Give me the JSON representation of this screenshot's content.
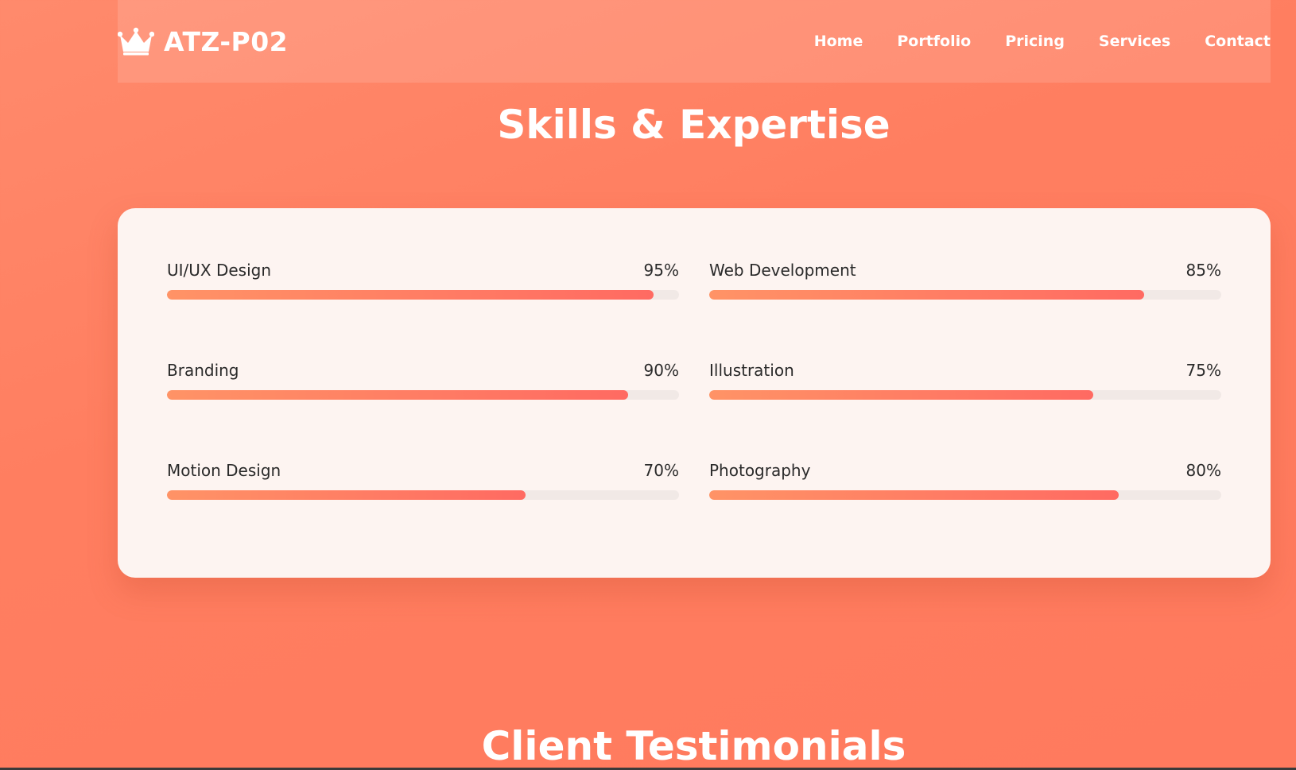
{
  "nav": {
    "brand_name": "ATZ-P02",
    "brand_icon": "crown-icon",
    "links": [
      "Home",
      "Portfolio",
      "Pricing",
      "Services",
      "Contact"
    ]
  },
  "skills_section": {
    "title": "Skills & Expertise",
    "skills": [
      {
        "name": "UI/UX Design",
        "percent_label": "95%",
        "level": 95
      },
      {
        "name": "Web Development",
        "percent_label": "85%",
        "level": 85
      },
      {
        "name": "Branding",
        "percent_label": "90%",
        "level": 90
      },
      {
        "name": "Illustration",
        "percent_label": "75%",
        "level": 75
      },
      {
        "name": "Motion Design",
        "percent_label": "70%",
        "level": 70
      },
      {
        "name": "Photography",
        "percent_label": "80%",
        "level": 80
      }
    ]
  },
  "testimonials_section": {
    "title": "Client Testimonials"
  },
  "colors": {
    "background": "#ff7e60",
    "card": "#fdf4f1",
    "bar_start": "#ff9366",
    "bar_end": "#ff6a62",
    "track": "#f1e9e6",
    "text_dark": "#2a2a2a",
    "text_light": "#ffffff"
  }
}
